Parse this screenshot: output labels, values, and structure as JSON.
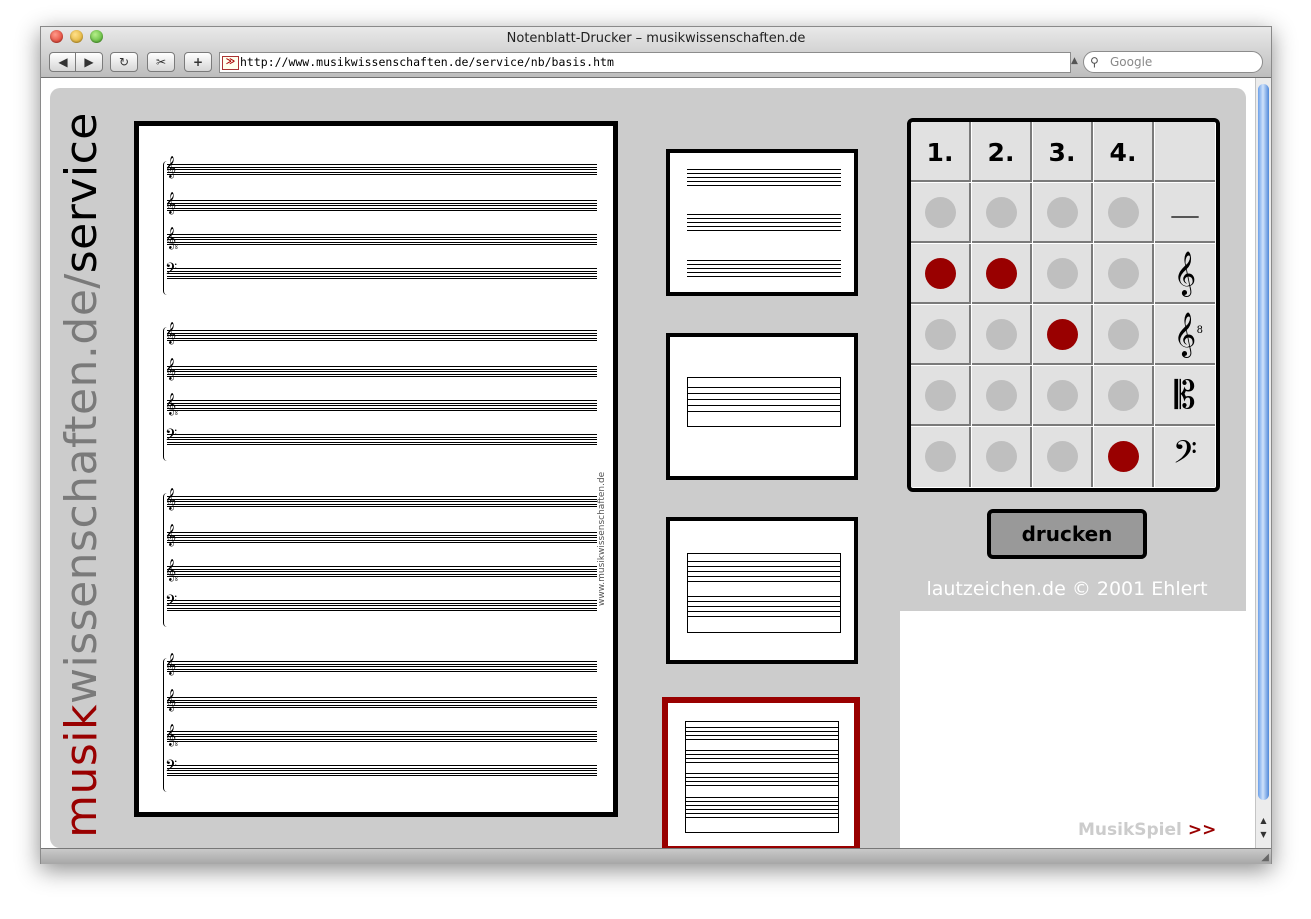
{
  "window": {
    "title": "Notenblatt-Drucker – musikwissenschaften.de"
  },
  "toolbar": {
    "back_icon": "◀",
    "forward_icon": "▶",
    "reload_icon": "↻",
    "screenshot_icon": "✂",
    "add_icon": "+",
    "url": "http://www.musikwissenschaften.de/service/nb/basis.htm",
    "url_favicon": "≫",
    "search_placeholder": "Google",
    "search_icon": "⚲"
  },
  "branding": {
    "part1": "musik",
    "part2": "wissenschaften.de/",
    "part3": "service"
  },
  "sheet": {
    "credit": "www.musikwissenschaften.de",
    "clefs": [
      "𝄞",
      "𝄞",
      "𝄠",
      "𝄢"
    ]
  },
  "grid": {
    "headers": [
      "1.",
      "2.",
      "3.",
      "4."
    ],
    "row_symbols": [
      "—",
      "𝄞",
      "𝄞",
      "𝄡",
      "𝄢"
    ],
    "octave_mark": "8",
    "selection": [
      [
        false,
        false,
        false,
        false
      ],
      [
        true,
        true,
        false,
        false
      ],
      [
        false,
        false,
        true,
        false
      ],
      [
        false,
        false,
        false,
        false
      ],
      [
        false,
        false,
        false,
        true
      ]
    ]
  },
  "print_button": "drucken",
  "copyright": "lautzeichen.de © 2001 Ehlert",
  "footer_link": {
    "label": "MusikSpiel",
    "arrow": ">>"
  },
  "colors": {
    "accent": "#990000",
    "panel": "#cccccc",
    "inactive_dot": "#bfbfbf"
  }
}
